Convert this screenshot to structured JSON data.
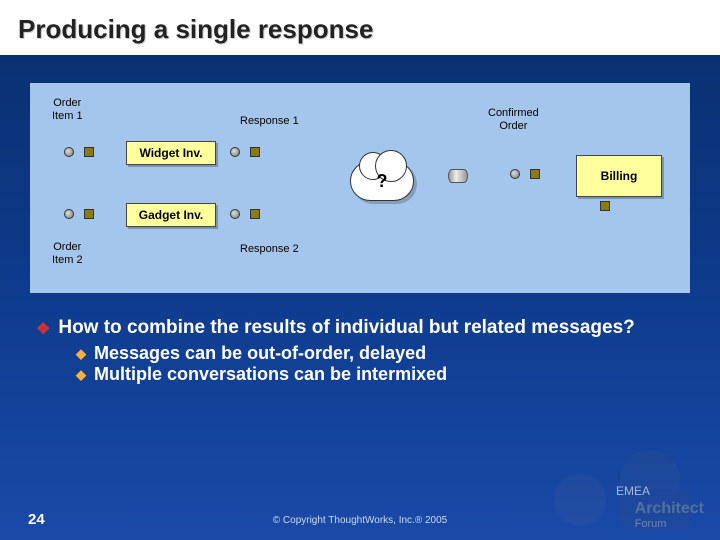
{
  "title": "Producing a single response",
  "diagram": {
    "order_item_1": "Order\nItem 1",
    "order_item_2": "Order\nItem 2",
    "response_1": "Response 1",
    "response_2": "Response 2",
    "widget_inv": "Widget Inv.",
    "gadget_inv": "Gadget Inv.",
    "confirmed_order": "Confirmed\nOrder",
    "billing": "Billing",
    "question": "?"
  },
  "bullets": {
    "main": "How to combine the results of individual but related messages?",
    "sub1": "Messages can be out-of-order, delayed",
    "sub2": "Multiple conversations can be intermixed"
  },
  "footer": {
    "page": "24",
    "copyright": "© Copyright ThoughtWorks, Inc.® 2005",
    "region": "EMEA",
    "brand1": "Architect",
    "brand2": "Forum"
  }
}
